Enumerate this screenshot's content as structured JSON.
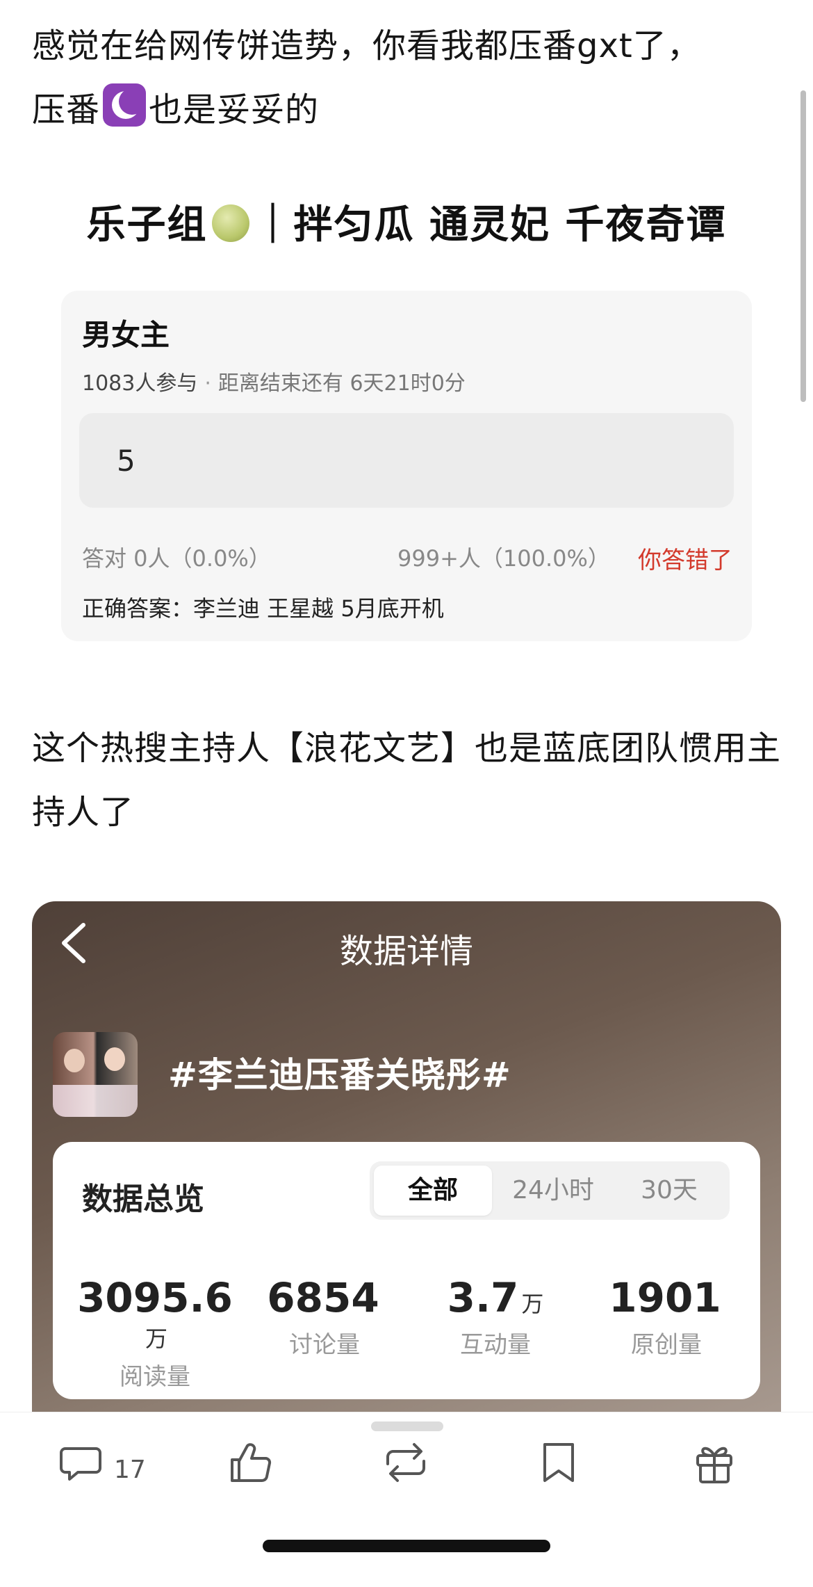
{
  "post": {
    "line1a": "感觉在给网传饼造势，你看我都压番gxt了，",
    "line1b": "压番",
    "line1c": "也是妥妥的",
    "line2": "这个热搜主持人【浪花文艺】也是蓝底团队惯用主持人了"
  },
  "quiz": {
    "title_a": "乐子组",
    "title_b": "｜拌匀瓜 通灵妃 千夜奇谭",
    "heading": "男女主",
    "participants": "1083人参与",
    "dot": "·",
    "deadline": "距离结束还有 6天21时0分",
    "answer": "5",
    "correct_stat": "答对  0人（0.0%）",
    "wrong_stat": "999+人（100.0%）",
    "result": "你答错了",
    "correct_answer": "正确答案：李兰迪 王星越 5月底开机"
  },
  "data_detail": {
    "title": "数据详情",
    "topic": "#李兰迪压番关晓彤#",
    "overview_title": "数据总览",
    "tabs": [
      "全部",
      "24小时",
      "30天"
    ],
    "active_tab": "全部",
    "metrics": [
      {
        "value": "3095.6",
        "unit": "万",
        "label": "阅读量"
      },
      {
        "value": "6854",
        "unit": "",
        "label": "讨论量"
      },
      {
        "value": "3.7",
        "unit": "万",
        "label": "互动量"
      },
      {
        "value": "1901",
        "unit": "",
        "label": "原创量"
      }
    ]
  },
  "bottom_bar": {
    "comment_count": "17"
  }
}
